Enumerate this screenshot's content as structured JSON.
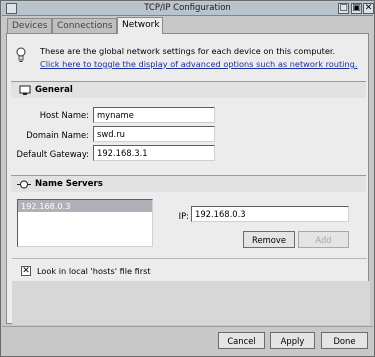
{
  "window": {
    "title": "TCP/IP Configuration"
  },
  "tabs": [
    {
      "label": "Devices"
    },
    {
      "label": "Connections"
    },
    {
      "label": "Network"
    }
  ],
  "info": {
    "line1": "These are the global network settings for each device on this computer.",
    "link": "Click here to toggle the display of advanced options such as network routing."
  },
  "general": {
    "title": "General",
    "host_label": "Host Name:",
    "host_value": "myname",
    "domain_label": "Domain Name:",
    "domain_value": "swd.ru",
    "gateway_label": "Default Gateway:",
    "gateway_value": "192.168.3.1"
  },
  "name_servers": {
    "title": "Name Servers",
    "list": [
      "192.168.0.3"
    ],
    "ip_label": "IP:",
    "ip_value": "192.168.0.3",
    "remove_label": "Remove",
    "add_label": "Add",
    "hosts_checkbox_label": "Look in local 'hosts' file first",
    "hosts_checked": true
  },
  "footer": {
    "cancel_label": "Cancel",
    "apply_label": "Apply",
    "done_label": "Done"
  },
  "icons": {
    "close": "close-icon",
    "minimize": "minimize-icon",
    "zoom": "zoom-icon",
    "info": "lightbulb-icon",
    "general": "computer-icon",
    "name_servers": "network-icon"
  }
}
